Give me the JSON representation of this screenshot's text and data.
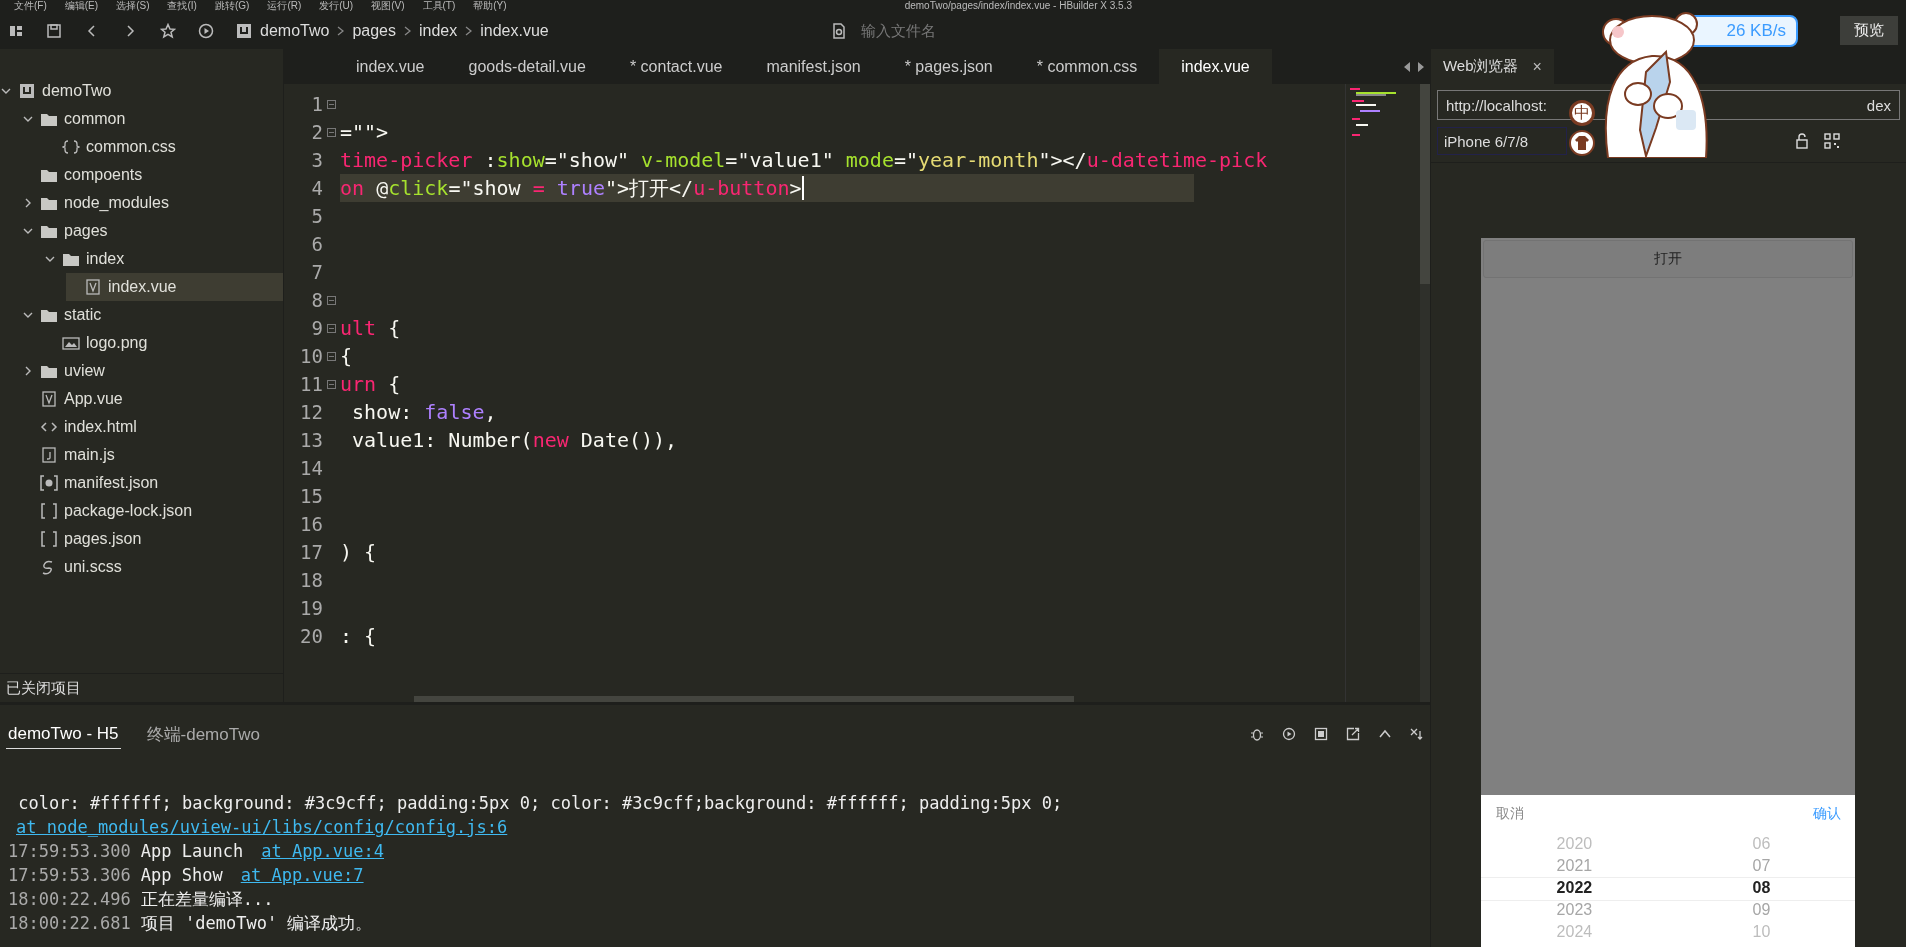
{
  "menu_bar": {
    "items": [
      "文件(F)",
      "编辑(E)",
      "选择(S)",
      "查找(I)",
      "跳转(G)",
      "运行(R)",
      "发行(U)",
      "视图(V)",
      "工具(T)",
      "帮助(Y)"
    ],
    "title": "demoTwo/pages/index/index.vue - HBuilder X 3.5.3"
  },
  "toolbar": {
    "breadcrumb": [
      "demoTwo",
      "pages",
      "index",
      "index.vue"
    ],
    "search": {
      "placeholder": "输入文件名"
    },
    "speed": "26 KB/s",
    "preview_button": "预览"
  },
  "sidebar": {
    "tree": [
      {
        "label": "demoTwo",
        "kind": "project",
        "expanded": true,
        "selected": false,
        "children": [
          {
            "label": "common",
            "kind": "folder",
            "expanded": true,
            "selected": false,
            "children": [
              {
                "label": "common.css",
                "kind": "css",
                "selected": false
              }
            ]
          },
          {
            "label": "compoents",
            "kind": "folder",
            "selected": false
          },
          {
            "label": "node_modules",
            "kind": "folder",
            "expanded": false,
            "selected": false
          },
          {
            "label": "pages",
            "kind": "folder",
            "expanded": true,
            "selected": false,
            "children": [
              {
                "label": "index",
                "kind": "folder",
                "expanded": true,
                "selected": false,
                "children": [
                  {
                    "label": "index.vue",
                    "kind": "vue",
                    "selected": true
                  }
                ]
              }
            ]
          },
          {
            "label": "static",
            "kind": "folder",
            "expanded": true,
            "selected": false,
            "children": [
              {
                "label": "logo.png",
                "kind": "image",
                "selected": false
              }
            ]
          },
          {
            "label": "uview",
            "kind": "folder",
            "expanded": false,
            "selected": false
          },
          {
            "label": "App.vue",
            "kind": "vue",
            "selected": false
          },
          {
            "label": "index.html",
            "kind": "html",
            "selected": false
          },
          {
            "label": "main.js",
            "kind": "js",
            "selected": false
          },
          {
            "label": "manifest.json",
            "kind": "manifest",
            "selected": false
          },
          {
            "label": "package-lock.json",
            "kind": "json",
            "selected": false
          },
          {
            "label": "pages.json",
            "kind": "json",
            "selected": false
          },
          {
            "label": "uni.scss",
            "kind": "scss",
            "selected": false
          }
        ]
      }
    ],
    "closed_projects": "已关闭项目"
  },
  "editor_tabs": [
    {
      "label": "index.vue",
      "selected": false
    },
    {
      "label": "goods-detail.vue",
      "selected": false
    },
    {
      "label": "* contact.vue",
      "selected": false
    },
    {
      "label": "manifest.json",
      "selected": false
    },
    {
      "label": "* pages.json",
      "selected": false
    },
    {
      "label": "* common.css",
      "selected": false
    },
    {
      "label": "index.vue",
      "selected": true
    }
  ],
  "editor": {
    "lines": [
      {
        "number": "1",
        "fold": true,
        "current": false
      },
      {
        "number": "2",
        "fold": true,
        "current": false,
        "tokens": [
          {
            "kind": "plain",
            "text": "=\"\">"
          }
        ]
      },
      {
        "number": "3",
        "fold": false,
        "current": false,
        "tokens": [
          {
            "kind": "tag",
            "text": "time-picker"
          },
          {
            "kind": "plain",
            "text": " :"
          },
          {
            "kind": "attr",
            "text": "show"
          },
          {
            "kind": "plain",
            "text": "=\"show\" "
          },
          {
            "kind": "attr",
            "text": "v-model"
          },
          {
            "kind": "plain",
            "text": "=\"value1\" "
          },
          {
            "kind": "attr",
            "text": "mode"
          },
          {
            "kind": "plain",
            "text": "=\""
          },
          {
            "kind": "string",
            "text": "year-month"
          },
          {
            "kind": "plain",
            "text": "\"></"
          },
          {
            "kind": "tag",
            "text": "u-datetime-pick"
          }
        ]
      },
      {
        "number": "4",
        "fold": false,
        "current": true,
        "tokens": [
          {
            "kind": "tag",
            "text": "on"
          },
          {
            "kind": "plain",
            "text": " @"
          },
          {
            "kind": "attr",
            "text": "click"
          },
          {
            "kind": "plain",
            "text": "=\"show "
          },
          {
            "kind": "tag",
            "text": "= "
          },
          {
            "kind": "const",
            "text": "true"
          },
          {
            "kind": "plain",
            "text": "\">打开</"
          },
          {
            "kind": "tag",
            "text": "u-button"
          },
          {
            "kind": "plain",
            "text": ">"
          }
        ]
      },
      {
        "number": "5",
        "fold": false,
        "current": false
      },
      {
        "number": "6",
        "fold": false,
        "current": false
      },
      {
        "number": "7",
        "fold": false,
        "current": false
      },
      {
        "number": "8",
        "fold": true,
        "current": false
      },
      {
        "number": "9",
        "fold": true,
        "current": false,
        "tokens": [
          {
            "kind": "tag",
            "text": "ult"
          },
          {
            "kind": "plain",
            "text": " {"
          }
        ]
      },
      {
        "number": "10",
        "fold": true,
        "current": false,
        "tokens": [
          {
            "kind": "plain",
            "text": "{"
          }
        ]
      },
      {
        "number": "11",
        "fold": true,
        "current": false,
        "tokens": [
          {
            "kind": "tag",
            "text": "urn"
          },
          {
            "kind": "plain",
            "text": " {"
          }
        ]
      },
      {
        "number": "12",
        "fold": false,
        "current": false,
        "tokens": [
          {
            "kind": "plain",
            "text": " show: "
          },
          {
            "kind": "const",
            "text": "false"
          },
          {
            "kind": "plain",
            "text": ","
          }
        ]
      },
      {
        "number": "13",
        "fold": false,
        "current": false,
        "tokens": [
          {
            "kind": "plain",
            "text": " value1: Number("
          },
          {
            "kind": "tag",
            "text": "new"
          },
          {
            "kind": "plain",
            "text": " Date()),"
          }
        ]
      },
      {
        "number": "14",
        "fold": false,
        "current": false
      },
      {
        "number": "15",
        "fold": false,
        "current": false
      },
      {
        "number": "16",
        "fold": false,
        "current": false
      },
      {
        "number": "17",
        "fold": false,
        "current": false,
        "tokens": [
          {
            "kind": "plain",
            "text": ") {"
          }
        ]
      },
      {
        "number": "18",
        "fold": false,
        "current": false
      },
      {
        "number": "19",
        "fold": false,
        "current": false
      },
      {
        "number": "20",
        "fold": false,
        "current": false,
        "tokens": [
          {
            "kind": "plain",
            "text": ": {"
          }
        ]
      }
    ]
  },
  "browser": {
    "tab": {
      "label": "Web浏览器",
      "close": "×"
    },
    "url_parts": [
      "http://localhost:",
      "dex"
    ],
    "device": "iPhone 6/7/8",
    "app": {
      "button": "打开",
      "picker": {
        "cancel": "取消",
        "confirm": "确认",
        "columns": [
          [
            {
              "label": "2020",
              "selected": false
            },
            {
              "label": "2021",
              "selected": false
            },
            {
              "label": "2022",
              "selected": true
            },
            {
              "label": "2023",
              "selected": false
            },
            {
              "label": "2024",
              "selected": false
            }
          ],
          [
            {
              "label": "06",
              "selected": false
            },
            {
              "label": "07",
              "selected": false
            },
            {
              "label": "08",
              "selected": true
            },
            {
              "label": "09",
              "selected": false
            },
            {
              "label": "10",
              "selected": false
            }
          ]
        ]
      }
    }
  },
  "ime": {
    "label": "中"
  },
  "console": {
    "tabs": [
      {
        "label": "demoTwo - H5",
        "selected": true
      },
      {
        "label": "终端-demoTwo",
        "selected": false
      }
    ],
    "lines": [
      {
        "text": " color: #ffffff; background: #3c9cff; padding:5px 0; color: #3c9cff;background: #ffffff; padding:5px 0;",
        "link": "at node_modules/uview-ui/libs/config/config.js:6"
      },
      {
        "time": "17:59:53.300",
        "text": "App Launch",
        "link": "at App.vue:4"
      },
      {
        "time": "17:59:53.306",
        "text": "App Show",
        "link": "at App.vue:7"
      },
      {
        "time": "18:00:22.496",
        "text": "正在差量编译..."
      },
      {
        "time": "18:00:22.681",
        "text": "项目 'demoTwo' 编译成功。"
      }
    ]
  }
}
